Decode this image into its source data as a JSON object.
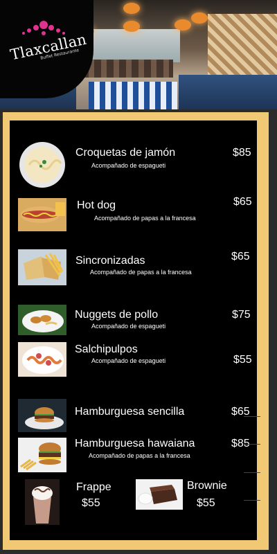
{
  "brand": {
    "name": "Tlaxcallan",
    "tagline": "Buffet Restaurante"
  },
  "menu": [
    {
      "name": "Croquetas de jamón",
      "description": "Acompañado de espagueti",
      "price": "$85",
      "image": "pasta-plate-photo"
    },
    {
      "name": "Hot dog",
      "description": "Acompañado de papas a la francesa",
      "price": "$65",
      "image": "hot-dog-photo"
    },
    {
      "name": "Sincronizadas",
      "description": "Acompañado de papas a la francesa",
      "price": "$65",
      "image": "sincronizadas-photo"
    },
    {
      "name": "Nuggets de pollo",
      "description": "Acompañado de espagueti",
      "price": "$75",
      "image": "nuggets-photo"
    },
    {
      "name": "Salchipulpos",
      "description": "Acompañado de espagueti",
      "price": "$55",
      "image": "salchipulpos-photo"
    },
    {
      "name": "Hamburguesa sencilla",
      "description": "",
      "price": "$65",
      "image": "burger-photo"
    },
    {
      "name": "Hamburguesa hawaiana",
      "description": "Acompañado de papas a la francesa",
      "price": "$85",
      "image": "hawaiian-burger-photo"
    }
  ],
  "drinks": [
    {
      "name": "Frappe",
      "price": "$55",
      "image": "frappe-photo"
    },
    {
      "name": "Brownie",
      "price": "$55",
      "image": "brownie-photo"
    }
  ],
  "colors": {
    "frame": "#f1c873",
    "board": "#000000",
    "text": "#ffffff",
    "lamp": "#e98a2c"
  }
}
